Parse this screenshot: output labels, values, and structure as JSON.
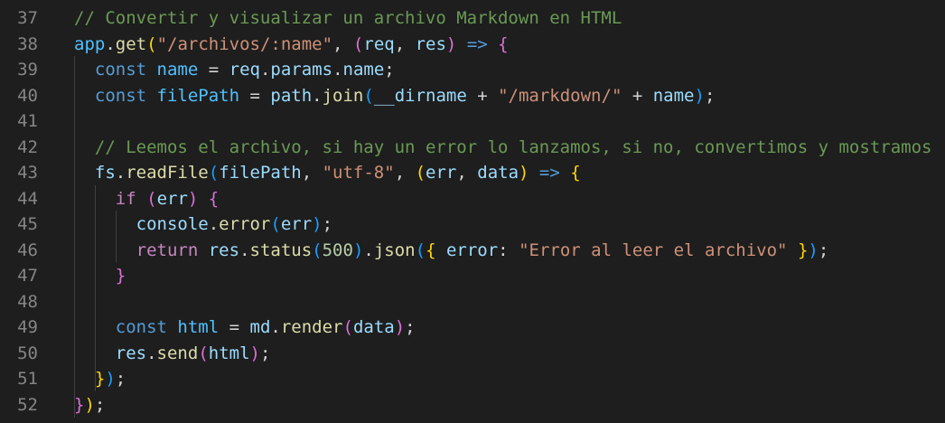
{
  "editor": {
    "theme_colors": {
      "background": "#1e1e1e",
      "line_number": "#858585",
      "keyword": "#569cd6",
      "control": "#c586c0",
      "variable": "#9cdcfe",
      "function": "#dcdcaa",
      "string": "#ce9178",
      "number": "#b5cea8",
      "comment": "#6a9955",
      "object": "#4fc1ff",
      "bracket_1": "#ffd700",
      "bracket_2": "#da70d6",
      "bracket_3": "#179fff"
    },
    "lines": [
      {
        "number": "37",
        "tokens": [
          {
            "t": "// Convertir y visualizar un archivo Markdown en HTML",
            "k": "cmt"
          }
        ]
      },
      {
        "number": "38",
        "tokens": [
          {
            "t": "app",
            "k": "obj"
          },
          {
            "t": ".",
            "k": "op"
          },
          {
            "t": "get",
            "k": "fn"
          },
          {
            "t": "(",
            "k": "b1"
          },
          {
            "t": "\"/archivos/:name\"",
            "k": "str"
          },
          {
            "t": ", ",
            "k": "op"
          },
          {
            "t": "(",
            "k": "b2"
          },
          {
            "t": "req",
            "k": "var"
          },
          {
            "t": ", ",
            "k": "op"
          },
          {
            "t": "res",
            "k": "var"
          },
          {
            "t": ")",
            "k": "b2"
          },
          {
            "t": " ",
            "k": "op"
          },
          {
            "t": "=>",
            "k": "kw"
          },
          {
            "t": " ",
            "k": "op"
          },
          {
            "t": "{",
            "k": "b2"
          }
        ]
      },
      {
        "number": "39",
        "tokens": [
          {
            "t": "  ",
            "k": "op"
          },
          {
            "t": "const",
            "k": "kw"
          },
          {
            "t": " ",
            "k": "op"
          },
          {
            "t": "name",
            "k": "obj"
          },
          {
            "t": " = ",
            "k": "op"
          },
          {
            "t": "req",
            "k": "var"
          },
          {
            "t": ".",
            "k": "op"
          },
          {
            "t": "params",
            "k": "var"
          },
          {
            "t": ".",
            "k": "op"
          },
          {
            "t": "name",
            "k": "var"
          },
          {
            "t": ";",
            "k": "op"
          }
        ]
      },
      {
        "number": "40",
        "tokens": [
          {
            "t": "  ",
            "k": "op"
          },
          {
            "t": "const",
            "k": "kw"
          },
          {
            "t": " ",
            "k": "op"
          },
          {
            "t": "filePath",
            "k": "obj"
          },
          {
            "t": " = ",
            "k": "op"
          },
          {
            "t": "path",
            "k": "var"
          },
          {
            "t": ".",
            "k": "op"
          },
          {
            "t": "join",
            "k": "fn"
          },
          {
            "t": "(",
            "k": "b3"
          },
          {
            "t": "__dirname",
            "k": "var"
          },
          {
            "t": " + ",
            "k": "op"
          },
          {
            "t": "\"/markdown/\"",
            "k": "str"
          },
          {
            "t": " + ",
            "k": "op"
          },
          {
            "t": "name",
            "k": "var"
          },
          {
            "t": ")",
            "k": "b3"
          },
          {
            "t": ";",
            "k": "op"
          }
        ]
      },
      {
        "number": "41",
        "tokens": []
      },
      {
        "number": "42",
        "tokens": [
          {
            "t": "  ",
            "k": "op"
          },
          {
            "t": "// Leemos el archivo, si hay un error lo lanzamos, si no, convertimos y mostramos",
            "k": "cmt"
          }
        ]
      },
      {
        "number": "43",
        "tokens": [
          {
            "t": "  ",
            "k": "op"
          },
          {
            "t": "fs",
            "k": "var"
          },
          {
            "t": ".",
            "k": "op"
          },
          {
            "t": "readFile",
            "k": "fn"
          },
          {
            "t": "(",
            "k": "b3"
          },
          {
            "t": "filePath",
            "k": "var"
          },
          {
            "t": ", ",
            "k": "op"
          },
          {
            "t": "\"utf-8\"",
            "k": "str"
          },
          {
            "t": ", ",
            "k": "op"
          },
          {
            "t": "(",
            "k": "b1"
          },
          {
            "t": "err",
            "k": "var"
          },
          {
            "t": ", ",
            "k": "op"
          },
          {
            "t": "data",
            "k": "var"
          },
          {
            "t": ")",
            "k": "b1"
          },
          {
            "t": " ",
            "k": "op"
          },
          {
            "t": "=>",
            "k": "kw"
          },
          {
            "t": " ",
            "k": "op"
          },
          {
            "t": "{",
            "k": "b1"
          }
        ]
      },
      {
        "number": "44",
        "tokens": [
          {
            "t": "    ",
            "k": "op"
          },
          {
            "t": "if",
            "k": "ctl"
          },
          {
            "t": " ",
            "k": "op"
          },
          {
            "t": "(",
            "k": "b2"
          },
          {
            "t": "err",
            "k": "var"
          },
          {
            "t": ")",
            "k": "b2"
          },
          {
            "t": " ",
            "k": "op"
          },
          {
            "t": "{",
            "k": "b2"
          }
        ]
      },
      {
        "number": "45",
        "tokens": [
          {
            "t": "      ",
            "k": "op"
          },
          {
            "t": "console",
            "k": "var"
          },
          {
            "t": ".",
            "k": "op"
          },
          {
            "t": "error",
            "k": "fn"
          },
          {
            "t": "(",
            "k": "b3"
          },
          {
            "t": "err",
            "k": "var"
          },
          {
            "t": ")",
            "k": "b3"
          },
          {
            "t": ";",
            "k": "op"
          }
        ]
      },
      {
        "number": "46",
        "tokens": [
          {
            "t": "      ",
            "k": "op"
          },
          {
            "t": "return",
            "k": "ctl"
          },
          {
            "t": " ",
            "k": "op"
          },
          {
            "t": "res",
            "k": "var"
          },
          {
            "t": ".",
            "k": "op"
          },
          {
            "t": "status",
            "k": "fn"
          },
          {
            "t": "(",
            "k": "b3"
          },
          {
            "t": "500",
            "k": "num"
          },
          {
            "t": ")",
            "k": "b3"
          },
          {
            "t": ".",
            "k": "op"
          },
          {
            "t": "json",
            "k": "fn"
          },
          {
            "t": "(",
            "k": "b3"
          },
          {
            "t": "{",
            "k": "b1"
          },
          {
            "t": " ",
            "k": "op"
          },
          {
            "t": "error",
            "k": "var"
          },
          {
            "t": ": ",
            "k": "op"
          },
          {
            "t": "\"Error al leer el archivo\"",
            "k": "str"
          },
          {
            "t": " ",
            "k": "op"
          },
          {
            "t": "}",
            "k": "b1"
          },
          {
            "t": ")",
            "k": "b3"
          },
          {
            "t": ";",
            "k": "op"
          }
        ]
      },
      {
        "number": "47",
        "tokens": [
          {
            "t": "    ",
            "k": "op"
          },
          {
            "t": "}",
            "k": "b2"
          }
        ]
      },
      {
        "number": "48",
        "tokens": []
      },
      {
        "number": "49",
        "tokens": [
          {
            "t": "    ",
            "k": "op"
          },
          {
            "t": "const",
            "k": "kw"
          },
          {
            "t": " ",
            "k": "op"
          },
          {
            "t": "html",
            "k": "obj"
          },
          {
            "t": " = ",
            "k": "op"
          },
          {
            "t": "md",
            "k": "var"
          },
          {
            "t": ".",
            "k": "op"
          },
          {
            "t": "render",
            "k": "fn"
          },
          {
            "t": "(",
            "k": "b2"
          },
          {
            "t": "data",
            "k": "var"
          },
          {
            "t": ")",
            "k": "b2"
          },
          {
            "t": ";",
            "k": "op"
          }
        ]
      },
      {
        "number": "50",
        "tokens": [
          {
            "t": "    ",
            "k": "op"
          },
          {
            "t": "res",
            "k": "var"
          },
          {
            "t": ".",
            "k": "op"
          },
          {
            "t": "send",
            "k": "fn"
          },
          {
            "t": "(",
            "k": "b2"
          },
          {
            "t": "html",
            "k": "var"
          },
          {
            "t": ")",
            "k": "b2"
          },
          {
            "t": ";",
            "k": "op"
          }
        ]
      },
      {
        "number": "51",
        "tokens": [
          {
            "t": "  ",
            "k": "op"
          },
          {
            "t": "}",
            "k": "b1"
          },
          {
            "t": ")",
            "k": "b3"
          },
          {
            "t": ";",
            "k": "op"
          }
        ]
      },
      {
        "number": "52",
        "tokens": [
          {
            "t": "}",
            "k": "b2"
          },
          {
            "t": ")",
            "k": "b1"
          },
          {
            "t": ";",
            "k": "op"
          }
        ]
      }
    ]
  }
}
